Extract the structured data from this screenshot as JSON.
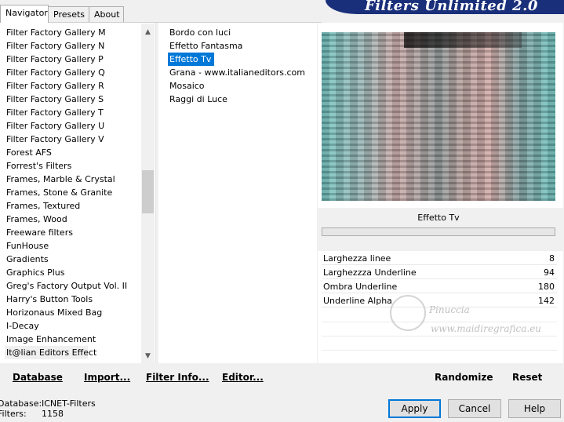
{
  "tabs": [
    "Navigator",
    "Presets",
    "About"
  ],
  "header_title": "Filters Unlimited 2.0",
  "categories": [
    "Filter Factory Gallery M",
    "Filter Factory Gallery N",
    "Filter Factory Gallery P",
    "Filter Factory Gallery Q",
    "Filter Factory Gallery R",
    "Filter Factory Gallery S",
    "Filter Factory Gallery T",
    "Filter Factory Gallery U",
    "Filter Factory Gallery V",
    "Forest AFS",
    "Forrest's Filters",
    "Frames, Marble & Crystal",
    "Frames, Stone & Granite",
    "Frames, Textured",
    "Frames, Wood",
    "Freeware filters",
    "FunHouse",
    "Gradients",
    "Graphics Plus",
    "Greg's Factory Output Vol. II",
    "Harry's Button Tools",
    "Horizonaus Mixed Bag",
    "I-Decay",
    "Image Enhancement",
    "It@lian Editors Effect"
  ],
  "selected_category": "It@lian Editors Effect",
  "filters": [
    "Bordo con luci",
    "Effetto Fantasma",
    "Effetto Tv",
    "Grana - www.italianeditors.com",
    "Mosaico",
    "Raggi di Luce"
  ],
  "selected_filter": "Effetto Tv",
  "effect_title": "Effetto Tv",
  "parameters": [
    {
      "name": "Larghezza linee",
      "value": "8"
    },
    {
      "name": "Larghezzza Underline",
      "value": "94"
    },
    {
      "name": "Ombra Underline",
      "value": "180"
    },
    {
      "name": "Underline Alpha",
      "value": "142"
    }
  ],
  "watermark": {
    "name": "Pinuccia",
    "url": "www.maidiregrafica.eu"
  },
  "toolbar": {
    "database": "Database",
    "import": "Import...",
    "filter_info": "Filter Info...",
    "editor": "Editor...",
    "randomize": "Randomize",
    "reset": "Reset"
  },
  "status": {
    "database_label": "Database:",
    "database_value": "ICNET-Filters",
    "filters_label": "Filters:",
    "filters_value": "1158"
  },
  "buttons": {
    "apply": "Apply",
    "cancel": "Cancel",
    "help": "Help"
  },
  "colors": {
    "selection": "#0078d7",
    "banner": "#1a2f7a"
  }
}
